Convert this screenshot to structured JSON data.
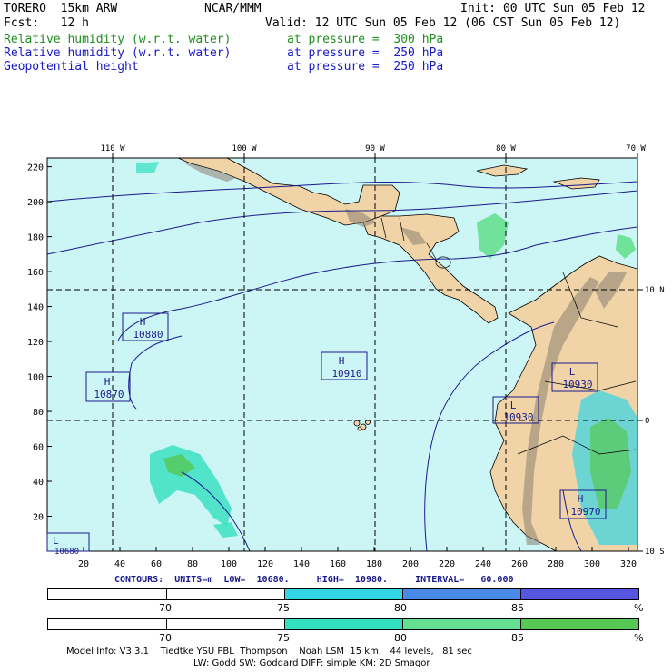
{
  "header": {
    "model": "TORERO  15km ARW",
    "center": "NCAR/MMM",
    "init": "Init: 00 UTC Sun 05 Feb 12",
    "fcst": "Fcst:   12 h",
    "valid": "Valid: 12 UTC Sun 05 Feb 12 (06 CST Sun 05 Feb 12)",
    "fields": [
      {
        "name": "Relative humidity (w.r.t. water)",
        "level": "at pressure =  300 hPa",
        "color": "#1f8f1f"
      },
      {
        "name": "Relative humidity (w.r.t. water)",
        "level": "at pressure =  250 hPa",
        "color": "#1a1ac8"
      },
      {
        "name": "Geopotential height",
        "level": "at pressure =  250 hPa",
        "color": "#1a1ac8"
      }
    ]
  },
  "map": {
    "lon_labels": [
      "110 W",
      "100 W",
      "90 W",
      "80 W",
      "70 W"
    ],
    "lat_labels": [
      "10 N",
      "0",
      "10 S"
    ],
    "x_ticks": [
      "20",
      "40",
      "60",
      "80",
      "100",
      "120",
      "140",
      "160",
      "180",
      "200",
      "220",
      "240",
      "260",
      "280",
      "300",
      "320"
    ],
    "y_ticks": [
      "220",
      "200",
      "180",
      "160",
      "140",
      "120",
      "100",
      "80",
      "60",
      "40",
      "20"
    ],
    "highs_lows": [
      {
        "type": "H",
        "value": "10880"
      },
      {
        "type": "H",
        "value": "10870"
      },
      {
        "type": "H",
        "value": "10910"
      },
      {
        "type": "L",
        "value": "10930"
      },
      {
        "type": "L",
        "value": "10930"
      },
      {
        "type": "H",
        "value": "10970"
      },
      {
        "type": "L",
        "value": "10680"
      }
    ],
    "colors": {
      "ocean": "#ccf5f5",
      "land": "#f0d4a8",
      "terrain_dark": "#8c7f70",
      "contour": "#1a1a8c",
      "coast": "#000000"
    }
  },
  "contours_line": "CONTOURS:  UNITS=m  LOW=  10680.     HIGH=  10980.     INTERVAL=   60.000",
  "colorbars": [
    {
      "labels": [
        "70",
        "75",
        "80",
        "85",
        "%"
      ],
      "colors": [
        "#ffffff",
        "#ffffff",
        "#33d6e6",
        "#4a8ae8",
        "#5555e0"
      ]
    },
    {
      "labels": [
        "70",
        "75",
        "80",
        "85",
        "%"
      ],
      "colors": [
        "#ffffff",
        "#ffffff",
        "#33e0c0",
        "#66e090",
        "#55c855"
      ]
    }
  ],
  "footer": {
    "line1": "Model Info: V3.3.1    Tiedtke YSU PBL  Thompson    Noah LSM  15 km,   44 levels,   81 sec",
    "line2": "LW: Godd SW: Goddard DIFF: simple KM: 2D Smagor"
  }
}
